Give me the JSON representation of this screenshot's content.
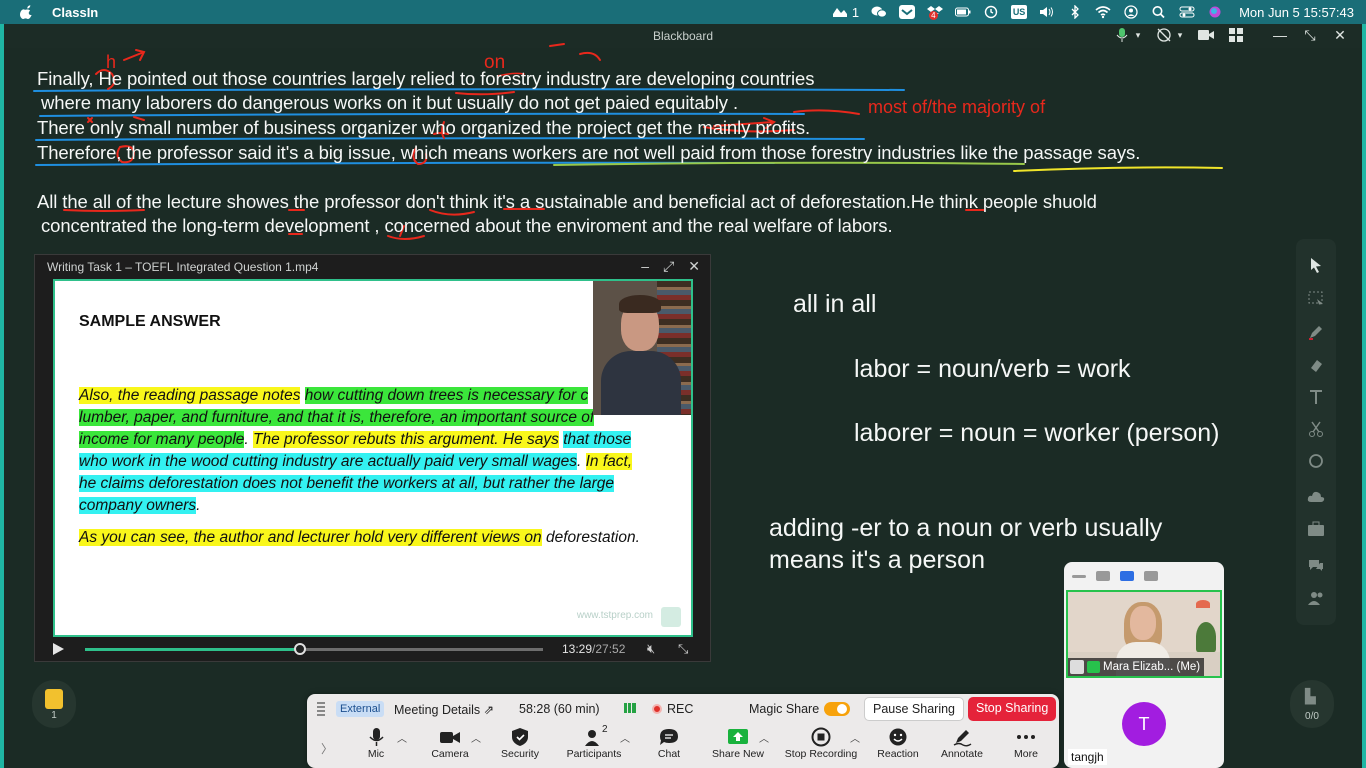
{
  "menubar": {
    "app_name": "ClassIn",
    "badge_count": "1",
    "notif_badge": "4",
    "lang": "US",
    "datetime": "Mon Jun 5  15:57:43"
  },
  "window": {
    "title": "Blackboard"
  },
  "board": {
    "lines": [
      "Finally, He pointed out those countries largely relied to forestry industry are developing countries",
      "where many laborers do dangerous works on it but usually do not get paied equitably .",
      "There only small number of business organizer who organized the project get the mainly profits.",
      "Therefore, the professor said it's a big issue, which means workers are not well paid from those forestry industries like the passage says.",
      "All the all of the lecture showes the professor don't think it's a sustainable and beneficial act of deforestation.He think people shuold",
      "concentrated the long-term development , concerned about the enviroment and the real welfare of labors."
    ],
    "red_correction": "most of/the majority of",
    "ink_h": "h",
    "ink_on": "on",
    "notes": {
      "all_in_all": "all in all",
      "labor": "labor = noun/verb = work",
      "laborer": "laborer = noun = worker (person)",
      "adding_line1": "adding -er to a noun or verb usually",
      "adding_line2": "means it's a person"
    }
  },
  "player": {
    "title": "Writing Task 1 – TOEFL Integrated Question 1.mp4",
    "sample_title": "SAMPLE ANSWER",
    "p1": {
      "y1": "Also, the reading passage notes",
      "g1": "how cutting down trees is necessary for c",
      "g2": "lumber, paper, and furniture, and that it is, therefore, an important source of",
      "g3": "income for many people",
      "plain1": ".",
      "y2": "The professor rebuts this argument. He says",
      "c1": "that those",
      "c2": "who work in the wood cutting industry are actually paid very small wages",
      "plain2": ".",
      "y3": "In fact,",
      "c3": "he claims deforestation does not benefit the workers at all, but rather the large",
      "c4": "company owners",
      "plain3": "."
    },
    "p2": {
      "y1": "As you can see, the author and lecturer hold very different views on",
      "plain1": "deforestation."
    },
    "watermark": "www.tstprep.com",
    "time_current": "13:29",
    "time_total": "/27:52",
    "progress": 0.47
  },
  "doc_button": {
    "count": "1"
  },
  "page_button": {
    "count": "0/0"
  },
  "zoom": {
    "external": "External",
    "meeting_details": "Meeting Details",
    "timer": "58:28  (60 min)",
    "rec": "REC",
    "magic_share": "Magic Share",
    "pause_sharing": "Pause Sharing",
    "stop_sharing": "Stop Sharing",
    "participants_count": "2",
    "buttons": {
      "mic": "Mic",
      "camera": "Camera",
      "security": "Security",
      "participants": "Participants",
      "chat": "Chat",
      "share_new": "Share New",
      "stop_recording": "Stop Recording",
      "reaction": "Reaction",
      "annotate": "Annotate",
      "more": "More"
    }
  },
  "zoom_panel": {
    "self_name": "Mara Elizab...  (Me)",
    "avatar_letter": "T",
    "other_name": "tangjh"
  },
  "colors": {
    "board_bg": "#1b2b25",
    "frame": "#1fb6a4",
    "ink_red": "#e8281c",
    "ink_blue": "#1f8fe0",
    "ink_yellow": "#f0e52a",
    "stop_red": "#e5233a"
  }
}
